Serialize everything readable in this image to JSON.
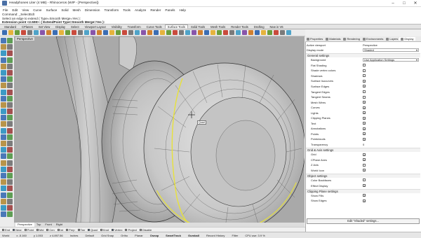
{
  "window": {
    "title": "Headphones Liter (4 MB) - Rhinoceros (WIP - [Perspective])",
    "buttons": [
      "–",
      "□",
      "✕"
    ]
  },
  "menu": [
    "File",
    "Edit",
    "View",
    "Curve",
    "Surface",
    "Solid",
    "Mesh",
    "Dimension",
    "Transform",
    "Tools",
    "Analyze",
    "Render",
    "Panels",
    "Help"
  ],
  "command_history": [
    "Command: _SelectEdt",
    "Select an edge to extend ( Type=Smooth  Merge=Yes ):",
    "Extension point <2.508>: ( ExtendPoint  Type=Smooth  Merge=Yes ):"
  ],
  "toolbar_tabs": [
    "Standard",
    "CPlanes",
    "Set View",
    "Display",
    "Select",
    "Viewport Layout",
    "Visibility",
    "Transform",
    "Curve Tools",
    "Surface Tools",
    "Solid Tools",
    "Mesh Tools",
    "Render Tools",
    "Drafting",
    "New in V6"
  ],
  "toolbar_tabs_active": 9,
  "viewport": {
    "label": "Perspective",
    "osnap_tooltip": "Quad",
    "tabs": [
      "Perspective",
      "Top",
      "Front",
      "Right"
    ],
    "active_tab": 0
  },
  "snaps": [
    {
      "label": "End",
      "on": false
    },
    {
      "label": "Near",
      "on": true
    },
    {
      "label": "Point",
      "on": false
    },
    {
      "label": "Mid",
      "on": false
    },
    {
      "label": "Cen",
      "on": false
    },
    {
      "label": "Int",
      "on": false
    },
    {
      "label": "Perp",
      "on": false
    },
    {
      "label": "Tan",
      "on": false
    },
    {
      "label": "Quad",
      "on": true
    },
    {
      "label": "Knot",
      "on": false
    },
    {
      "label": "Vertex",
      "on": true
    },
    {
      "label": "Project",
      "on": false
    },
    {
      "label": "Disable",
      "on": false
    }
  ],
  "status": {
    "cplane": "World",
    "x": "x -5.160",
    "y": "y 1.053",
    "z": "z 4.897.56",
    "units": "Inches",
    "layer": "Default",
    "grid_snap": "Grid Snap",
    "ortho": "Ortho",
    "planar": "Planar",
    "osnap": "Osnap",
    "smarttrack": "SmartTrack",
    "gumball": "Gumball",
    "record_history": "Record History",
    "filter": "Filter",
    "cpu": "CPU use: 3.9 %"
  },
  "panel": {
    "tabs": [
      "Properties",
      "Materials",
      "Rendering",
      "Environments",
      "Layers",
      "Display"
    ],
    "active_tab": 5,
    "rows": [
      {
        "type": "field",
        "label": "Active viewport",
        "value": "Perspective"
      },
      {
        "type": "select",
        "label": "Display mode",
        "value": "Shaded"
      },
      {
        "type": "section",
        "label": "General settings"
      },
      {
        "type": "select",
        "label": "Background",
        "value": "Use Application Settings",
        "indent": true
      },
      {
        "type": "check",
        "label": "Flat Shading",
        "checked": false,
        "indent": true
      },
      {
        "type": "check",
        "label": "Shade vertex colors",
        "checked": false,
        "indent": true
      },
      {
        "type": "check",
        "label": "Shadows",
        "checked": false,
        "indent": true
      },
      {
        "type": "check",
        "label": "Surface Isocurves",
        "checked": true,
        "indent": true
      },
      {
        "type": "check",
        "label": "Surface Edges",
        "checked": true,
        "indent": true
      },
      {
        "type": "check",
        "label": "Tangent Edges",
        "checked": false,
        "indent": true
      },
      {
        "type": "check",
        "label": "Tangent Seams",
        "checked": false,
        "indent": true
      },
      {
        "type": "check",
        "label": "Mesh Wires",
        "checked": true,
        "indent": true
      },
      {
        "type": "check",
        "label": "Curves",
        "checked": true,
        "indent": true
      },
      {
        "type": "check",
        "label": "Lights",
        "checked": true,
        "indent": true
      },
      {
        "type": "check",
        "label": "Clipping Planes",
        "checked": true,
        "indent": true
      },
      {
        "type": "check",
        "label": "Text",
        "checked": true,
        "indent": true
      },
      {
        "type": "check",
        "label": "Annotations",
        "checked": true,
        "indent": true
      },
      {
        "type": "check",
        "label": "Points",
        "checked": true,
        "indent": true
      },
      {
        "type": "check",
        "label": "Pointclouds",
        "checked": true,
        "indent": true
      },
      {
        "type": "field",
        "label": "Transparency",
        "value": "0",
        "indent": true
      },
      {
        "type": "section",
        "label": "Grid & Axis settings"
      },
      {
        "type": "check",
        "label": "Grid",
        "checked": true,
        "indent": true
      },
      {
        "type": "check",
        "label": "CPlane Axes",
        "checked": true,
        "indent": true
      },
      {
        "type": "check",
        "label": "Z Axis",
        "checked": false,
        "indent": true
      },
      {
        "type": "check",
        "label": "World Icon",
        "checked": true,
        "indent": true
      },
      {
        "type": "section",
        "label": "Object settings"
      },
      {
        "type": "check",
        "label": "Color Backfaces",
        "checked": false,
        "indent": true
      },
      {
        "type": "check",
        "label": "Effect Display",
        "checked": true,
        "indent": true
      },
      {
        "type": "section",
        "label": "Clipping Plane settings"
      },
      {
        "type": "check",
        "label": "Show Fills",
        "checked": true,
        "indent": true
      },
      {
        "type": "check",
        "label": "Show Edges",
        "checked": true,
        "indent": true
      }
    ],
    "edit_button": "Edit \"Shaded\" settings..."
  },
  "colors": {
    "selection_edge": "#e8e23a",
    "viewport_bg": "#a8a8a8",
    "accent": "#3a6ea5"
  }
}
